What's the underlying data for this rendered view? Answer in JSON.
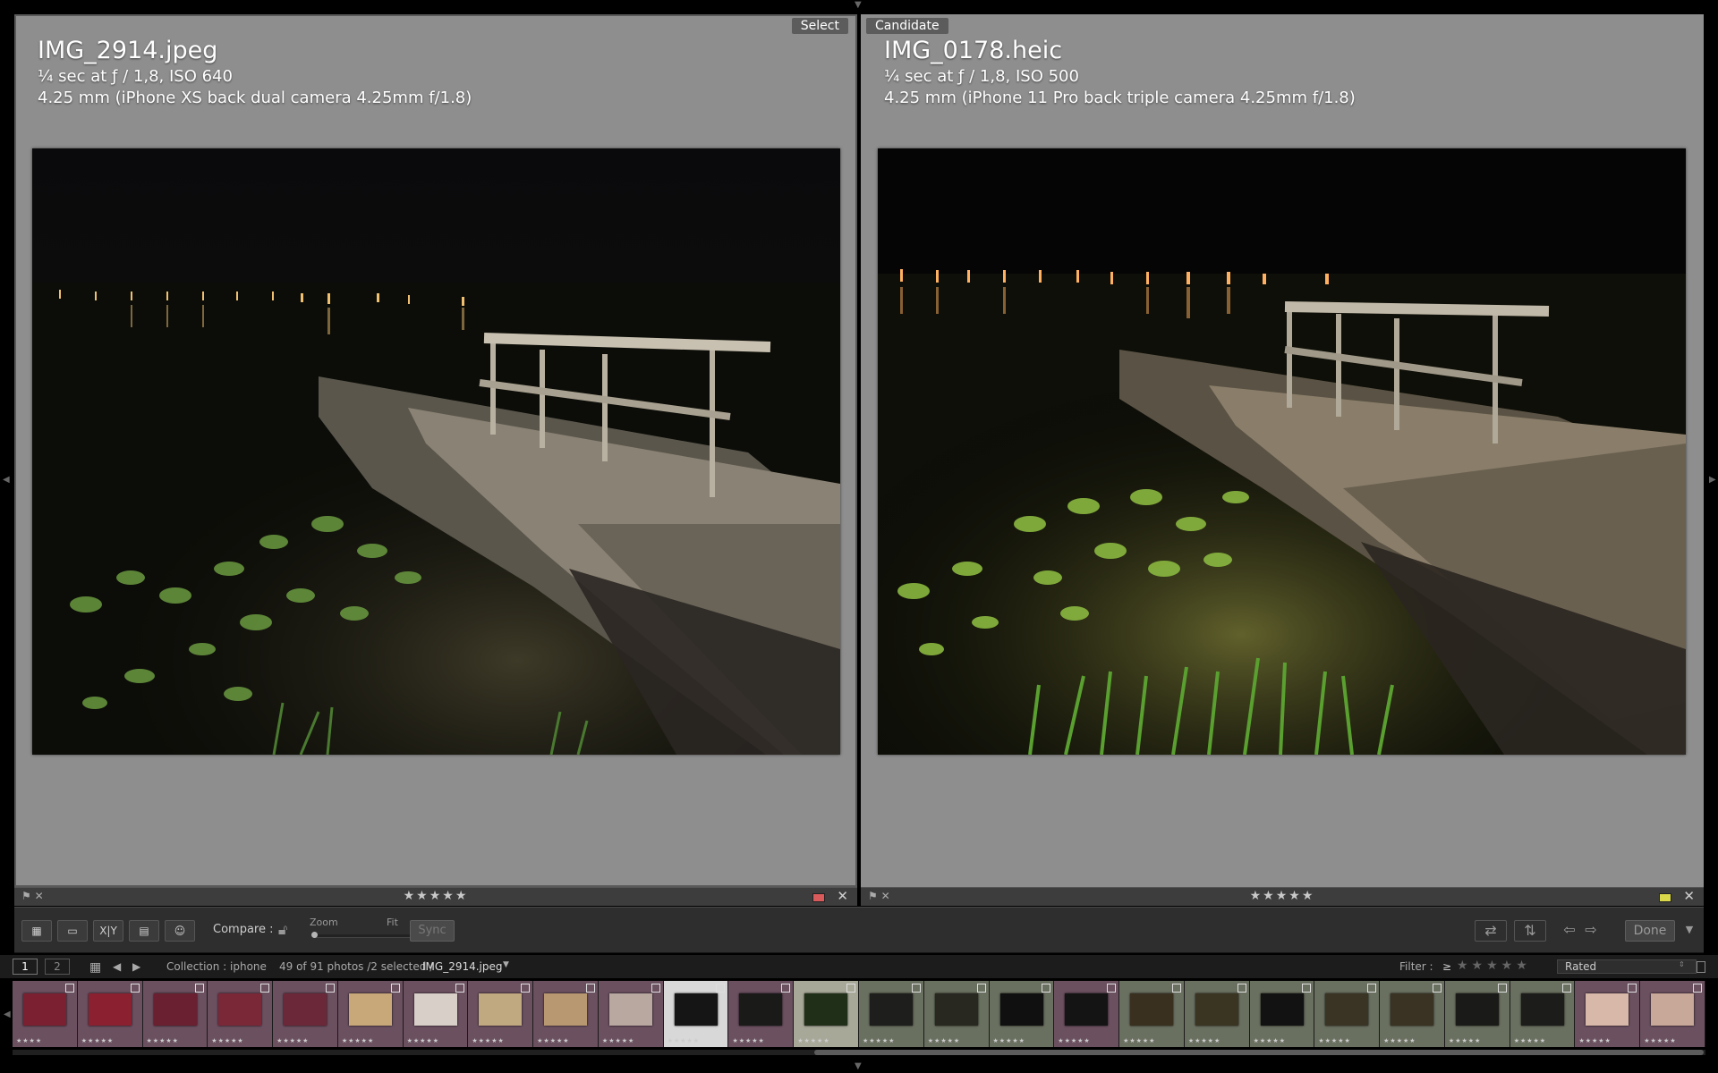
{
  "left": {
    "tag": "Select",
    "filename": "IMG_2914.jpeg",
    "exposure": "¼ sec at ƒ / 1,8, ISO 640",
    "lens": "4.25 mm (iPhone XS back dual camera 4.25mm f/1.8)",
    "stars": "★★★★★",
    "label_color": "#d85a5a"
  },
  "right": {
    "tag": "Candidate",
    "filename": "IMG_0178.heic",
    "exposure": "¼ sec at ƒ / 1,8, ISO 500",
    "lens": "4.25 mm (iPhone 11 Pro back triple camera 4.25mm f/1.8)",
    "stars": "★★★★★",
    "label_color": "#d8d84a"
  },
  "toolbar": {
    "compare_label": "Compare :",
    "zoom_label": "Zoom",
    "fit_label": "Fit",
    "sync_label": "Sync",
    "done_label": "Done",
    "xy_label": "X|Y"
  },
  "filmbar": {
    "page1": "1",
    "page2": "2",
    "collection": "Collection : iphone",
    "count": "49 of 91 photos /2 selected /",
    "current": "IMG_2914.jpeg",
    "filter_label": "Filter :",
    "filter_op": "≥",
    "filter_stars": "★★★★★",
    "filter_value": "Rated"
  },
  "filmstrip": [
    {
      "bg": "#6b5060",
      "thumb": "#7a2030",
      "stars": "★★★★"
    },
    {
      "bg": "#6b5060",
      "thumb": "#8a2030",
      "stars": "★★★★★"
    },
    {
      "bg": "#6b5060",
      "thumb": "#6a2030",
      "stars": "★★★★★"
    },
    {
      "bg": "#6b5060",
      "thumb": "#7a2838",
      "stars": "★★★★★"
    },
    {
      "bg": "#6b5060",
      "thumb": "#6a2838",
      "stars": "★★★★★"
    },
    {
      "bg": "#6b5060",
      "thumb": "#c8a878",
      "stars": "★★★★★"
    },
    {
      "bg": "#6b5060",
      "thumb": "#d8d0c8",
      "stars": "★★★★★"
    },
    {
      "bg": "#6b5060",
      "thumb": "#c0a880",
      "stars": "★★★★★"
    },
    {
      "bg": "#6b5060",
      "thumb": "#b89870",
      "stars": "★★★★★"
    },
    {
      "bg": "#6b5060",
      "thumb": "#b8a8a0",
      "stars": "★★★★★"
    },
    {
      "bg": "#d8d8d8",
      "thumb": "#151515",
      "stars": "★★★★★"
    },
    {
      "bg": "#6b5060",
      "thumb": "#1a1a18",
      "stars": "★★★★★"
    },
    {
      "bg": "#a8a898",
      "thumb": "#203018",
      "stars": "★★★★★"
    },
    {
      "bg": "#6a7060",
      "thumb": "#1e1e1c",
      "stars": "★★★★★"
    },
    {
      "bg": "#6a7060",
      "thumb": "#282820",
      "stars": "★★★★★"
    },
    {
      "bg": "#6a7060",
      "thumb": "#101010",
      "stars": "★★★★★"
    },
    {
      "bg": "#6b5060",
      "thumb": "#141414",
      "stars": "★★★★★"
    },
    {
      "bg": "#6a7060",
      "thumb": "#3a3020",
      "stars": "★★★★★"
    },
    {
      "bg": "#6a7060",
      "thumb": "#3a3422",
      "stars": "★★★★★"
    },
    {
      "bg": "#6a7060",
      "thumb": "#121212",
      "stars": "★★★★★"
    },
    {
      "bg": "#6a7060",
      "thumb": "#3a3424",
      "stars": "★★★★★"
    },
    {
      "bg": "#6a7060",
      "thumb": "#3a3222",
      "stars": "★★★★★"
    },
    {
      "bg": "#6a7060",
      "thumb": "#1a1a18",
      "stars": "★★★★★"
    },
    {
      "bg": "#6a7060",
      "thumb": "#1c1c1a",
      "stars": "★★★★★"
    },
    {
      "bg": "#6b5060",
      "thumb": "#d8b8a8",
      "stars": "★★★★★"
    },
    {
      "bg": "#6b5060",
      "thumb": "#c8a898",
      "stars": "★★★★★"
    }
  ]
}
